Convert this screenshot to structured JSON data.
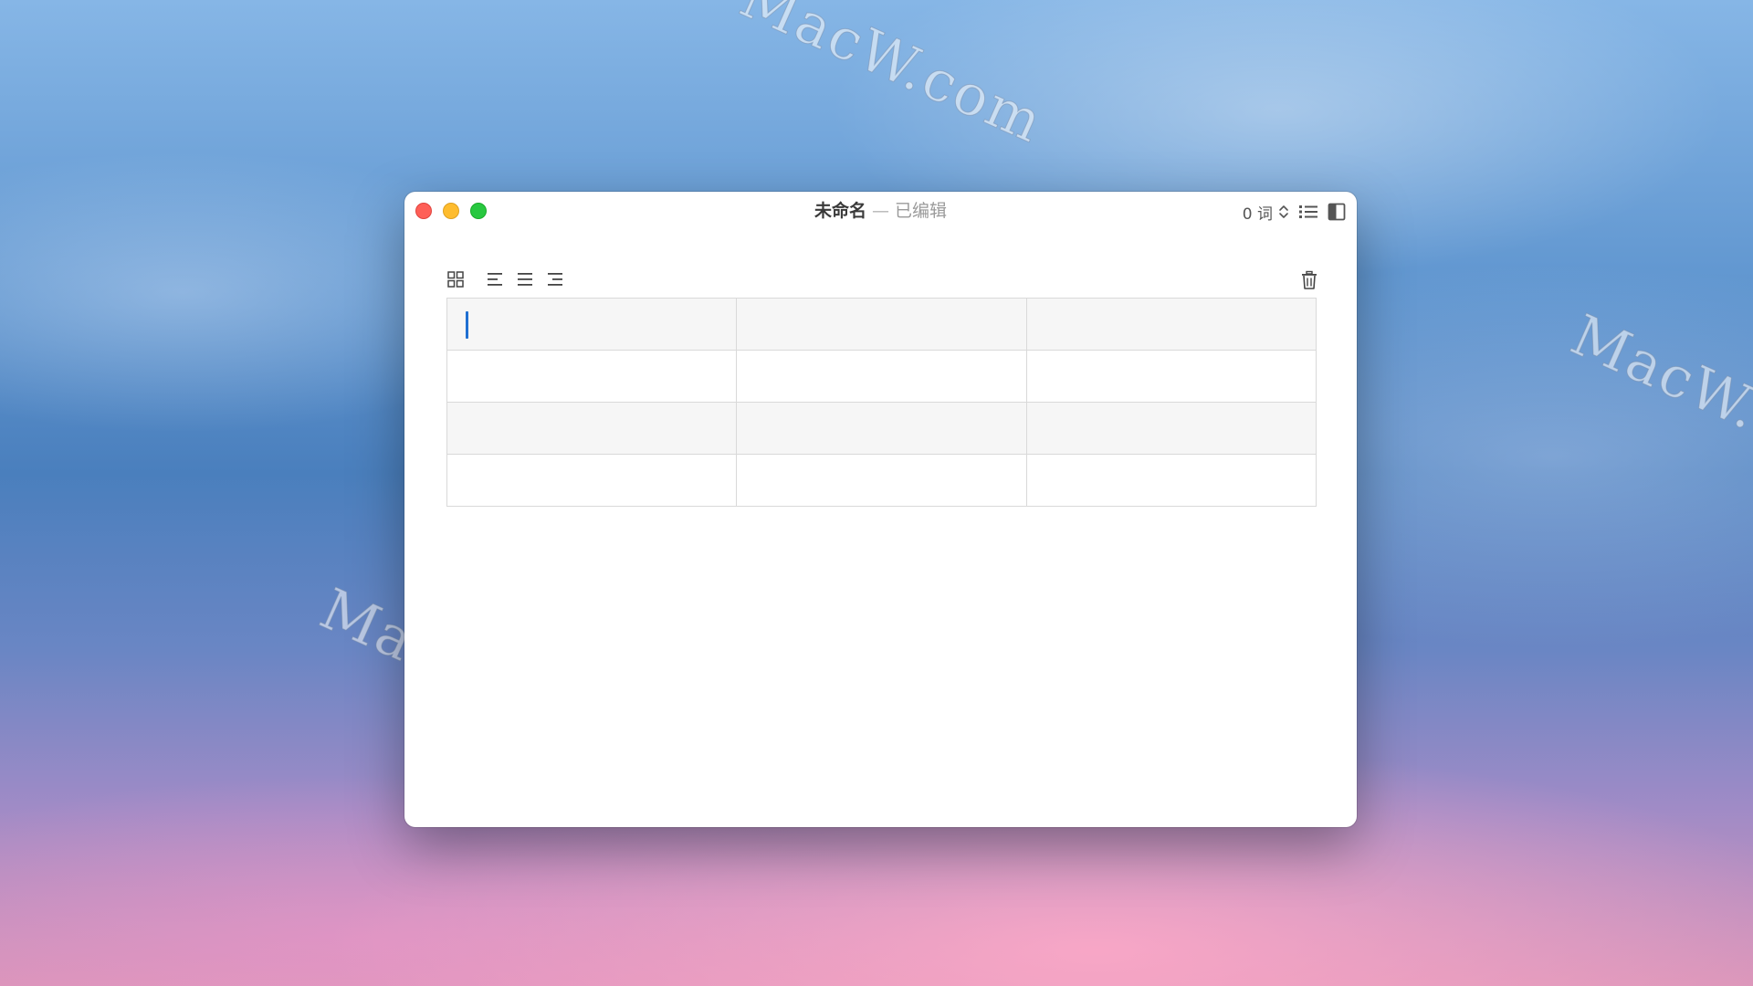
{
  "window": {
    "title_name": "未命名",
    "title_separator": "—",
    "title_state": "已编辑"
  },
  "titlebar": {
    "word_count": "0 词",
    "icons": [
      "stepper-icon",
      "list-icon",
      "sidebar-icon"
    ]
  },
  "toolbar": {
    "icons": [
      "grid-icon",
      "align-left-icon",
      "align-justify-icon",
      "align-right-icon"
    ],
    "delete_icon": "trash-icon"
  },
  "table": {
    "rows": [
      [
        "",
        "",
        ""
      ],
      [
        "",
        "",
        ""
      ],
      [
        "",
        "",
        ""
      ],
      [
        "",
        "",
        ""
      ]
    ],
    "cursor_cell": [
      0,
      0
    ]
  },
  "watermarks": [
    "MacW.com",
    "MacW.c",
    "MacW.com"
  ],
  "colors": {
    "close": "#fe5f57",
    "minimize": "#febc2e",
    "maximize": "#28c840",
    "caret": "#1f6fd1"
  }
}
